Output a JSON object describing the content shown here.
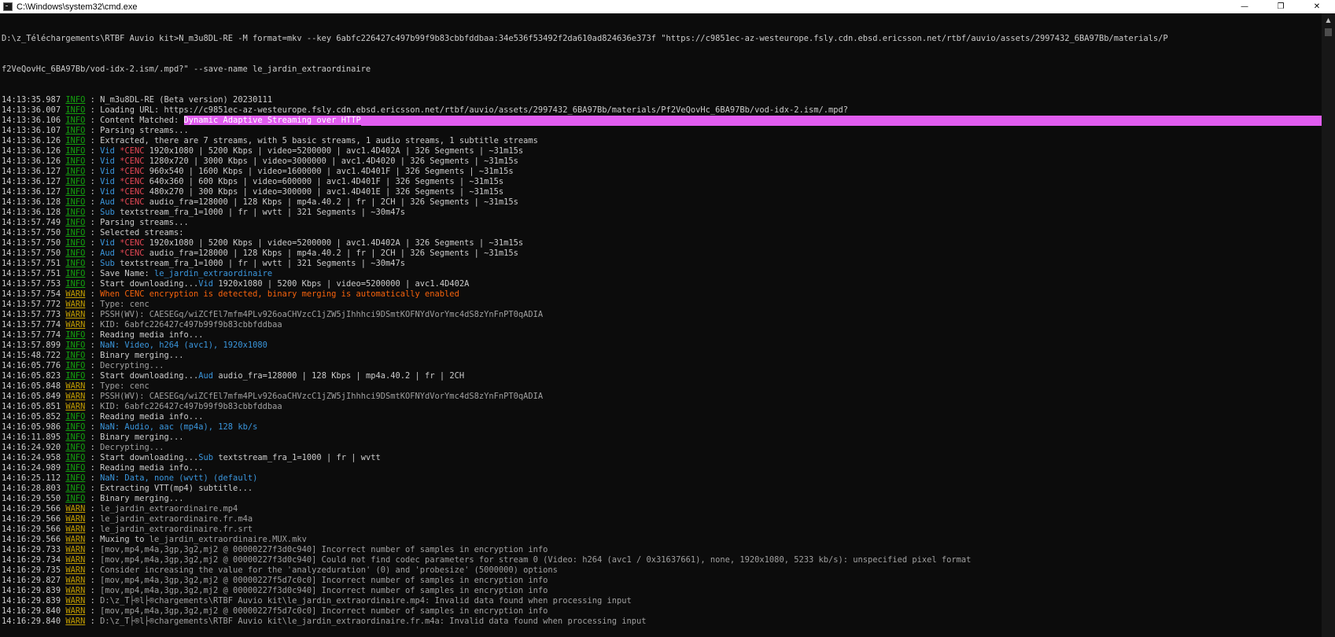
{
  "window": {
    "title": "C:\\Windows\\system32\\cmd.exe",
    "controls": {
      "minimize": "—",
      "maximize": "❐",
      "close": "✕"
    }
  },
  "terminal": {
    "command_line_1": "D:\\z_Téléchargements\\RTBF Auvio kit>N_m3u8DL-RE -M format=mkv --key 6abfc226427c497b99f9b83cbbfddbaa:34e536f53492f2da610ad824636e373f \"https://c9851ec-az-westeurope.fsly.cdn.ebsd.ericsson.net/rtbf/auvio/assets/2997432_6BA97Bb/materials/P",
    "command_line_2": "f2VeQovHc_6BA97Bb/vod-idx-2.ism/.mpd?\" --save-name le_jardin_extraordinaire",
    "lines": [
      {
        "t": "14:13:35.987",
        "tag": "INFO",
        "parts": [
          {
            "c": "",
            "s": "N_m3u8DL-RE (Beta version) 20230111"
          }
        ]
      },
      {
        "t": "14:13:36.007",
        "tag": "INFO",
        "parts": [
          {
            "c": "",
            "s": "Loading URL: https://c9851ec-az-westeurope.fsly.cdn.ebsd.ericsson.net/rtbf/auvio/assets/2997432_6BA97Bb/materials/Pf2VeQovHc_6BA97Bb/vod-idx-2.ism/.mpd?"
          }
        ]
      },
      {
        "t": "14:13:36.106",
        "tag": "INFO",
        "highlight": true,
        "parts": [
          {
            "c": "",
            "s": "Content Matched: "
          },
          {
            "c": "hl",
            "s": "Dynamic Adaptive Streaming over HTTP"
          }
        ]
      },
      {
        "t": "14:13:36.107",
        "tag": "INFO",
        "parts": [
          {
            "c": "",
            "s": "Parsing streams..."
          }
        ]
      },
      {
        "t": "14:13:36.126",
        "tag": "INFO",
        "parts": [
          {
            "c": "",
            "s": "Extracted, there are 7 streams, with 5 basic streams, 1 audio streams, 1 subtitle streams"
          }
        ]
      },
      {
        "t": "14:13:36.126",
        "tag": "INFO",
        "parts": [
          {
            "c": "blue",
            "s": "Vid "
          },
          {
            "c": "red",
            "s": "*CENC"
          },
          {
            "c": "",
            "s": " 1920x1080 | 5200 Kbps | video=5200000 | avc1.4D402A | 326 Segments | ~31m15s"
          }
        ]
      },
      {
        "t": "14:13:36.126",
        "tag": "INFO",
        "parts": [
          {
            "c": "blue",
            "s": "Vid "
          },
          {
            "c": "red",
            "s": "*CENC"
          },
          {
            "c": "",
            "s": " 1280x720 | 3000 Kbps | video=3000000 | avc1.4D4020 | 326 Segments | ~31m15s"
          }
        ]
      },
      {
        "t": "14:13:36.127",
        "tag": "INFO",
        "parts": [
          {
            "c": "blue",
            "s": "Vid "
          },
          {
            "c": "red",
            "s": "*CENC"
          },
          {
            "c": "",
            "s": " 960x540 | 1600 Kbps | video=1600000 | avc1.4D401F | 326 Segments | ~31m15s"
          }
        ]
      },
      {
        "t": "14:13:36.127",
        "tag": "INFO",
        "parts": [
          {
            "c": "blue",
            "s": "Vid "
          },
          {
            "c": "red",
            "s": "*CENC"
          },
          {
            "c": "",
            "s": " 640x360 | 600 Kbps | video=600000 | avc1.4D401F | 326 Segments | ~31m15s"
          }
        ]
      },
      {
        "t": "14:13:36.127",
        "tag": "INFO",
        "parts": [
          {
            "c": "blue",
            "s": "Vid "
          },
          {
            "c": "red",
            "s": "*CENC"
          },
          {
            "c": "",
            "s": " 480x270 | 300 Kbps | video=300000 | avc1.4D401E | 326 Segments | ~31m15s"
          }
        ]
      },
      {
        "t": "14:13:36.128",
        "tag": "INFO",
        "parts": [
          {
            "c": "blue",
            "s": "Aud "
          },
          {
            "c": "red",
            "s": "*CENC"
          },
          {
            "c": "",
            "s": " audio_fra=128000 | 128 Kbps | mp4a.40.2 | fr | 2CH | 326 Segments | ~31m15s"
          }
        ]
      },
      {
        "t": "14:13:36.128",
        "tag": "INFO",
        "parts": [
          {
            "c": "blue",
            "s": "Sub"
          },
          {
            "c": "",
            "s": " textstream_fra_1=1000 | fr | wvtt | 321 Segments | ~30m47s"
          }
        ]
      },
      {
        "t": "14:13:57.749",
        "tag": "INFO",
        "parts": [
          {
            "c": "",
            "s": "Parsing streams..."
          }
        ]
      },
      {
        "t": "14:13:57.750",
        "tag": "INFO",
        "parts": [
          {
            "c": "",
            "s": "Selected streams:"
          }
        ]
      },
      {
        "t": "14:13:57.750",
        "tag": "INFO",
        "parts": [
          {
            "c": "blue",
            "s": "Vid "
          },
          {
            "c": "red",
            "s": "*CENC"
          },
          {
            "c": "",
            "s": " 1920x1080 | 5200 Kbps | video=5200000 | avc1.4D402A | 326 Segments | ~31m15s"
          }
        ]
      },
      {
        "t": "14:13:57.750",
        "tag": "INFO",
        "parts": [
          {
            "c": "blue",
            "s": "Aud "
          },
          {
            "c": "red",
            "s": "*CENC"
          },
          {
            "c": "",
            "s": " audio_fra=128000 | 128 Kbps | mp4a.40.2 | fr | 2CH | 326 Segments | ~31m15s"
          }
        ]
      },
      {
        "t": "14:13:57.751",
        "tag": "INFO",
        "parts": [
          {
            "c": "blue",
            "s": "Sub"
          },
          {
            "c": "",
            "s": " textstream_fra_1=1000 | fr | wvtt | 321 Segments | ~30m47s"
          }
        ]
      },
      {
        "t": "14:13:57.751",
        "tag": "INFO",
        "parts": [
          {
            "c": "",
            "s": "Save Name: "
          },
          {
            "c": "blue",
            "s": "le_jardin_extraordinaire"
          }
        ]
      },
      {
        "t": "14:13:57.753",
        "tag": "INFO",
        "parts": [
          {
            "c": "",
            "s": "Start downloading..."
          },
          {
            "c": "blue",
            "s": "Vid"
          },
          {
            "c": "",
            "s": " 1920x1080 | 5200 Kbps | video=5200000 | avc1.4D402A"
          }
        ]
      },
      {
        "t": "14:13:57.754",
        "tag": "WARN",
        "parts": [
          {
            "c": "orange",
            "s": "When CENC encryption is detected, binary merging is automatically enabled"
          }
        ]
      },
      {
        "t": "14:13:57.772",
        "tag": "WARN",
        "parts": [
          {
            "c": "gray",
            "s": "Type: cenc"
          }
        ]
      },
      {
        "t": "14:13:57.773",
        "tag": "WARN",
        "parts": [
          {
            "c": "gray",
            "s": "PSSH(WV): CAESEGq/wiZCfEl7mfm4PLv926oaCHVzcC1jZW5jIhhhci9DSmtKOFNYdVorYmc4dS8zYnFnPT0qADIA"
          }
        ]
      },
      {
        "t": "14:13:57.774",
        "tag": "WARN",
        "parts": [
          {
            "c": "gray",
            "s": "KID: 6abfc226427c497b99f9b83cbbfddbaa"
          }
        ]
      },
      {
        "t": "14:13:57.774",
        "tag": "INFO",
        "parts": [
          {
            "c": "",
            "s": "Reading media info..."
          }
        ]
      },
      {
        "t": "14:13:57.899",
        "tag": "INFO",
        "parts": [
          {
            "c": "blue",
            "s": "NaN: Video, h264 (avc1), 1920x1080"
          }
        ]
      },
      {
        "t": "14:15:48.722",
        "tag": "INFO",
        "parts": [
          {
            "c": "",
            "s": "Binary merging..."
          }
        ]
      },
      {
        "t": "14:16:05.776",
        "tag": "INFO",
        "parts": [
          {
            "c": "gray",
            "s": "Decrypting..."
          }
        ]
      },
      {
        "t": "14:16:05.823",
        "tag": "INFO",
        "parts": [
          {
            "c": "",
            "s": "Start downloading..."
          },
          {
            "c": "blue",
            "s": "Aud"
          },
          {
            "c": "",
            "s": " audio_fra=128000 | 128 Kbps | mp4a.40.2 | fr | 2CH"
          }
        ]
      },
      {
        "t": "14:16:05.848",
        "tag": "WARN",
        "parts": [
          {
            "c": "gray",
            "s": "Type: cenc"
          }
        ]
      },
      {
        "t": "14:16:05.849",
        "tag": "WARN",
        "parts": [
          {
            "c": "gray",
            "s": "PSSH(WV): CAESEGq/wiZCfEl7mfm4PLv926oaCHVzcC1jZW5jIhhhci9DSmtKOFNYdVorYmc4dS8zYnFnPT0qADIA"
          }
        ]
      },
      {
        "t": "14:16:05.851",
        "tag": "WARN",
        "parts": [
          {
            "c": "gray",
            "s": "KID: 6abfc226427c497b99f9b83cbbfddbaa"
          }
        ]
      },
      {
        "t": "14:16:05.852",
        "tag": "INFO",
        "parts": [
          {
            "c": "",
            "s": "Reading media info..."
          }
        ]
      },
      {
        "t": "14:16:05.986",
        "tag": "INFO",
        "parts": [
          {
            "c": "blue",
            "s": "NaN: Audio, aac (mp4a), 128 kb/s"
          }
        ]
      },
      {
        "t": "14:16:11.895",
        "tag": "INFO",
        "parts": [
          {
            "c": "",
            "s": "Binary merging..."
          }
        ]
      },
      {
        "t": "14:16:24.920",
        "tag": "INFO",
        "parts": [
          {
            "c": "gray",
            "s": "Decrypting..."
          }
        ]
      },
      {
        "t": "14:16:24.958",
        "tag": "INFO",
        "parts": [
          {
            "c": "",
            "s": "Start downloading..."
          },
          {
            "c": "blue",
            "s": "Sub"
          },
          {
            "c": "",
            "s": " textstream_fra_1=1000 | fr | wvtt"
          }
        ]
      },
      {
        "t": "14:16:24.989",
        "tag": "INFO",
        "parts": [
          {
            "c": "",
            "s": "Reading media info..."
          }
        ]
      },
      {
        "t": "14:16:25.112",
        "tag": "INFO",
        "parts": [
          {
            "c": "blue",
            "s": "NaN: Data, none (wvtt) (default)"
          }
        ]
      },
      {
        "t": "14:16:28.803",
        "tag": "INFO",
        "parts": [
          {
            "c": "",
            "s": "Extracting VTT(mp4) subtitle..."
          }
        ]
      },
      {
        "t": "14:16:29.550",
        "tag": "INFO",
        "parts": [
          {
            "c": "",
            "s": "Binary merging..."
          }
        ]
      },
      {
        "t": "14:16:29.566",
        "tag": "WARN",
        "parts": [
          {
            "c": "gray",
            "s": "le_jardin_extraordinaire.mp4"
          }
        ]
      },
      {
        "t": "14:16:29.566",
        "tag": "WARN",
        "parts": [
          {
            "c": "gray",
            "s": "le_jardin_extraordinaire.fr.m4a"
          }
        ]
      },
      {
        "t": "14:16:29.566",
        "tag": "WARN",
        "parts": [
          {
            "c": "gray",
            "s": "le_jardin_extraordinaire.fr.srt"
          }
        ]
      },
      {
        "t": "14:16:29.566",
        "tag": "WARN",
        "parts": [
          {
            "c": "",
            "s": "Muxing to "
          },
          {
            "c": "gray",
            "s": "le_jardin_extraordinaire.MUX.mkv"
          }
        ]
      },
      {
        "t": "14:16:29.733",
        "tag": "WARN",
        "parts": [
          {
            "c": "gray",
            "s": "[mov,mp4,m4a,3gp,3g2,mj2 @ 00000227f3d0c940] Incorrect number of samples in encryption info"
          }
        ]
      },
      {
        "t": "14:16:29.734",
        "tag": "WARN",
        "parts": [
          {
            "c": "gray",
            "s": "[mov,mp4,m4a,3gp,3g2,mj2 @ 00000227f3d0c940] Could not find codec parameters for stream 0 (Video: h264 (avc1 / 0x31637661), none, 1920x1080, 5233 kb/s): unspecified pixel format"
          }
        ]
      },
      {
        "t": "14:16:29.735",
        "tag": "WARN",
        "parts": [
          {
            "c": "gray",
            "s": "Consider increasing the value for the 'analyzeduration' (0) and 'probesize' (5000000) options"
          }
        ]
      },
      {
        "t": "14:16:29.827",
        "tag": "WARN",
        "parts": [
          {
            "c": "gray",
            "s": "[mov,mp4,m4a,3gp,3g2,mj2 @ 00000227f5d7c0c0] Incorrect number of samples in encryption info"
          }
        ]
      },
      {
        "t": "14:16:29.839",
        "tag": "WARN",
        "parts": [
          {
            "c": "gray",
            "s": "[mov,mp4,m4a,3gp,3g2,mj2 @ 00000227f3d0c940] Incorrect number of samples in encryption info"
          }
        ]
      },
      {
        "t": "14:16:29.839",
        "tag": "WARN",
        "parts": [
          {
            "c": "gray",
            "s": "D:\\z_T├®l├®chargements\\RTBF Auvio kit\\le_jardin_extraordinaire.mp4: Invalid data found when processing input"
          }
        ]
      },
      {
        "t": "14:16:29.840",
        "tag": "WARN",
        "parts": [
          {
            "c": "gray",
            "s": "[mov,mp4,m4a,3gp,3g2,mj2 @ 00000227f5d7c0c0] Incorrect number of samples in encryption info"
          }
        ]
      },
      {
        "t": "14:16:29.840",
        "tag": "WARN",
        "parts": [
          {
            "c": "gray",
            "s": "D:\\z_T├®l├®chargements\\RTBF Auvio kit\\le_jardin_extraordinaire.fr.m4a: Invalid data found when processing input"
          }
        ]
      }
    ]
  },
  "scrollbar": {
    "up_arrow": "▲"
  },
  "colors": {
    "background": "#0c0c0c",
    "text": "#cccccc",
    "info": "#13a10e",
    "warn": "#c19c00",
    "blue": "#3a96dd",
    "red": "#e74856",
    "orange": "#f7630c",
    "highlight": "#e15df0"
  },
  "icons": {
    "app": "cmd-icon"
  }
}
